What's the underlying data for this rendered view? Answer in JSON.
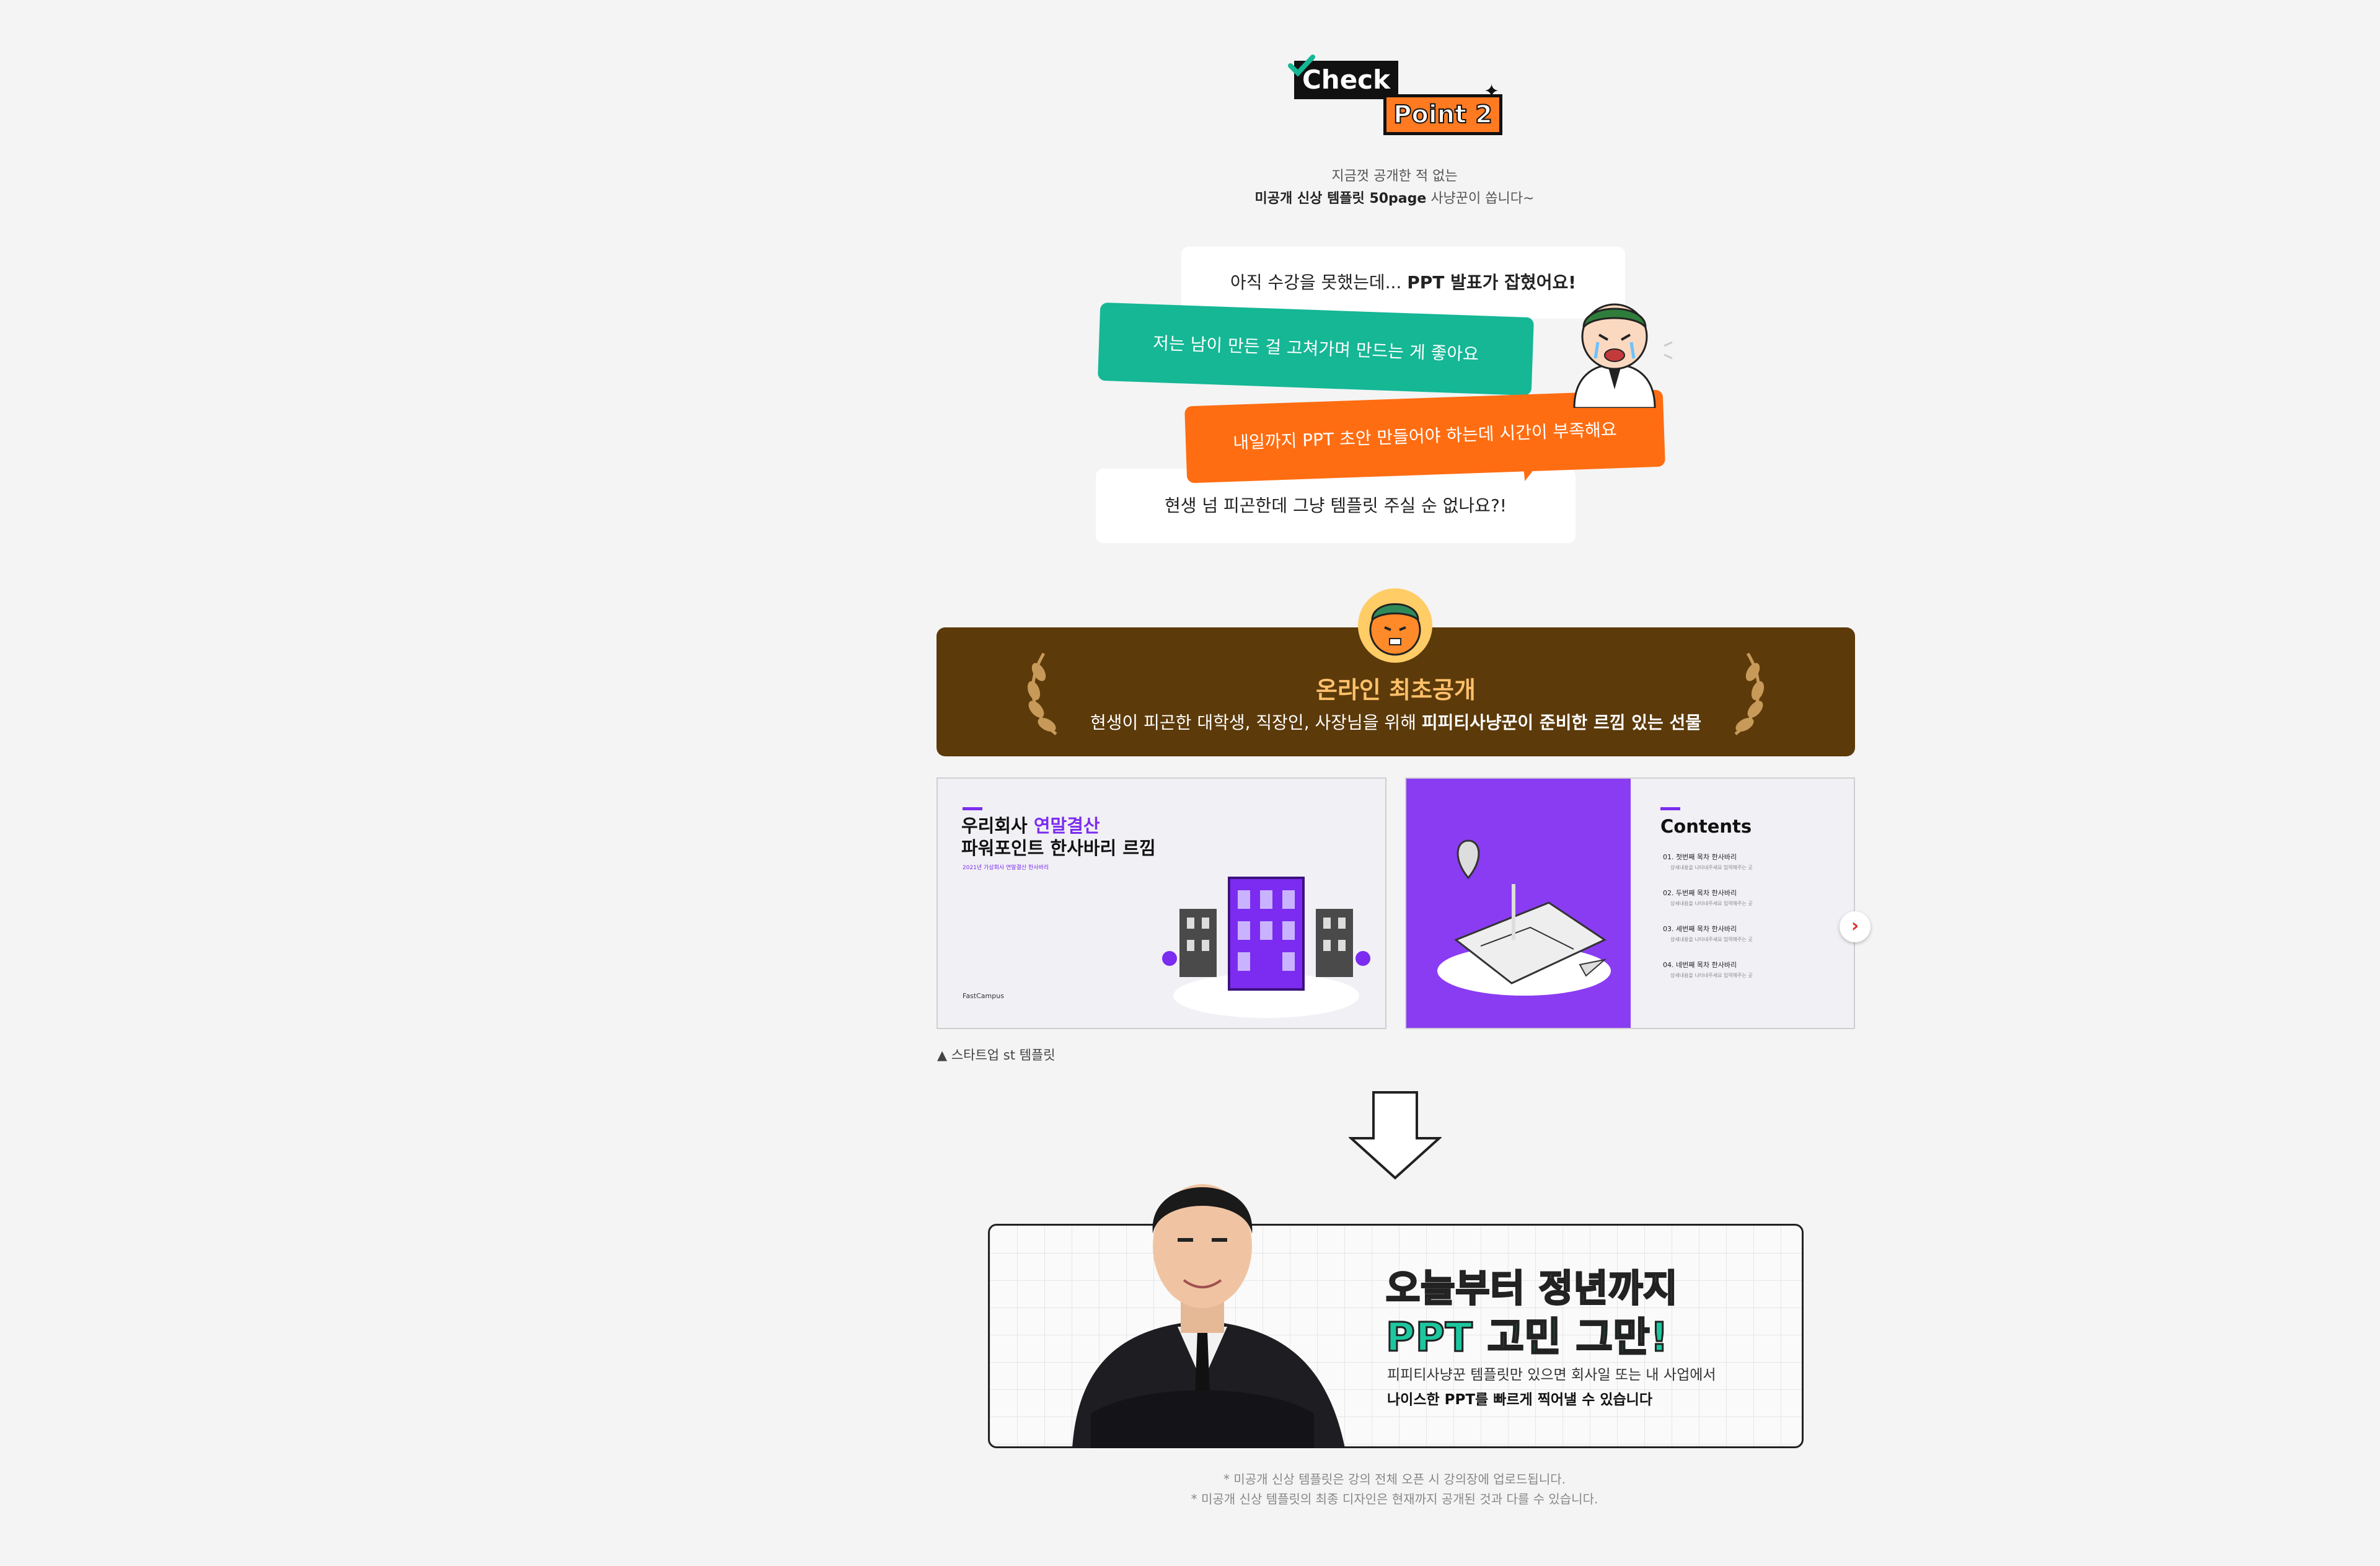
{
  "badge": {
    "check": "Check",
    "point": "Point 2"
  },
  "intro": {
    "line1": "지금껏 공개한 적 없는",
    "line2_bold": "미공개 신상 템플릿 50page",
    "line2_rest": " 사냥꾼이 쏩니다~"
  },
  "bubbles": {
    "b1_plain": "아직 수강을 못했는데... ",
    "b1_bold": "PPT 발표가 잡혔어요!",
    "b2": "저는 남이 만든 걸 고쳐가며 만드는 게 좋아요",
    "b3": "내일까지 PPT 초안 만들어야 하는데 시간이 부족해요",
    "b4": "현생 넘 피곤한데 그냥 템플릿 주실 순 없나요?!"
  },
  "banner": {
    "title": "온라인 최초공개",
    "sub_plain": "현생이 피곤한 대학생, 직장인, 사장님을 위해 ",
    "sub_bold": "피피티사냥꾼이 준비한 르낌 있는 선물"
  },
  "slide1": {
    "title_a": "우리회사 ",
    "title_accent": "연말결산",
    "title_b": "파워포인트 한사바리 르낌",
    "small": "2021년 가상회사 연말결산 한사바리",
    "footer": "FastCampus"
  },
  "slide2": {
    "title": "Contents",
    "items": [
      {
        "label": "01. 첫번째 목차 한사바리",
        "sub": "상세내용을 나타내주세요 입력해주는 곳"
      },
      {
        "label": "02. 두번째 목차 한사바리",
        "sub": "상세내용을 나타내주세요 입력해주는 곳"
      },
      {
        "label": "03. 세번째 목차 한사바리",
        "sub": "상세내용을 나타내주세요 입력해주는 곳"
      },
      {
        "label": "04. 네번째 목차 한사바리",
        "sub": "상세내용을 나타내주세요 입력해주는 곳"
      }
    ]
  },
  "carousel": {
    "next_icon": "chevron-right-icon"
  },
  "caption": "▲ 스타트업 st 템플릿",
  "promo": {
    "h1": "오늘부터 정년까지",
    "h2": "PPT 고민 그만!",
    "p1": "피피티사냥꾼 템플릿만 있으면 회사일 또는 내 사업에서",
    "p2": "나이스한 PPT를 빠르게 찍어낼 수 있습니다"
  },
  "notes": [
    "* 미공개 신상 템플릿은 강의 전체 오픈 시 강의장에 업로드됩니다.",
    "* 미공개 신상 템플릿의 최종 디자인은 현재까지 공개된 것과 다를 수 있습니다."
  ],
  "colors": {
    "orange": "#ff6d12",
    "teal": "#15b795",
    "brown": "#5c3a0a",
    "purple": "#8a3cf2",
    "gold": "#ffc16b"
  }
}
